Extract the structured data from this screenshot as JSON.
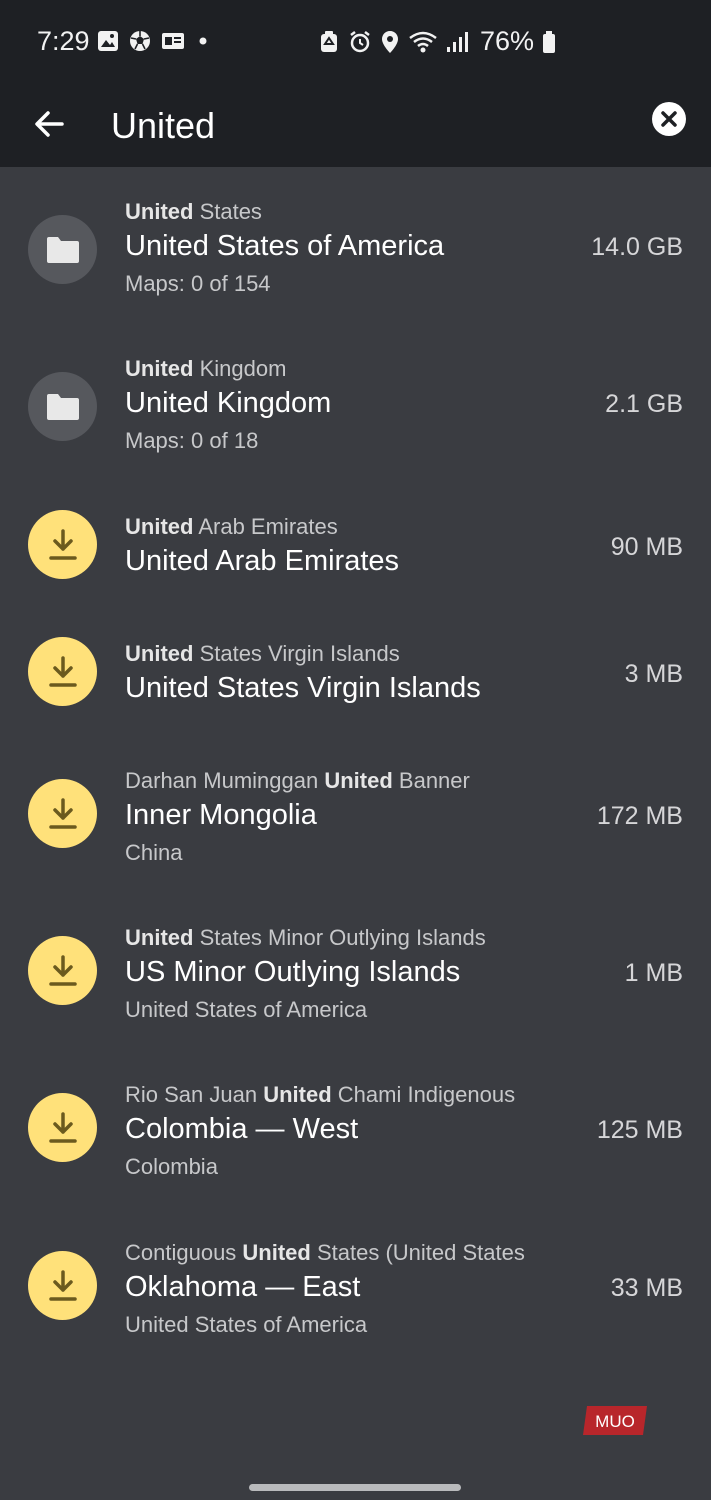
{
  "status_bar": {
    "time": "7:29",
    "battery_percent": "76%",
    "icons_left": [
      "gallery-icon",
      "soccer-ball-icon",
      "news-icon",
      "dot-icon"
    ],
    "icons_right": [
      "recycle-icon",
      "alarm-icon",
      "location-icon",
      "wifi-icon",
      "signal-icon",
      "battery-icon"
    ]
  },
  "app_bar": {
    "search_value": "United",
    "back_icon": "arrow-left-icon",
    "clear_icon": "close-circle-icon"
  },
  "results": [
    {
      "icon": "folder-icon",
      "kind": "folder",
      "sub_top_before": "",
      "sub_top_bold": "United",
      "sub_top_after": " States",
      "title": "United States of America",
      "sub_bottom": "Maps: 0 of 154",
      "size": "14.0 GB"
    },
    {
      "icon": "folder-icon",
      "kind": "folder",
      "sub_top_before": "",
      "sub_top_bold": "United",
      "sub_top_after": " Kingdom",
      "title": "United Kingdom",
      "sub_bottom": "Maps: 0 of 18",
      "size": "2.1 GB"
    },
    {
      "icon": "download-icon",
      "kind": "download",
      "sub_top_before": "",
      "sub_top_bold": "United",
      "sub_top_after": " Arab Emirates",
      "title": "United Arab Emirates",
      "sub_bottom": "",
      "size": "90 MB"
    },
    {
      "icon": "download-icon",
      "kind": "download",
      "sub_top_before": "",
      "sub_top_bold": "United",
      "sub_top_after": " States Virgin Islands",
      "title": "United States Virgin Islands",
      "sub_bottom": "",
      "size": "3 MB"
    },
    {
      "icon": "download-icon",
      "kind": "download",
      "sub_top_before": "Darhan Muminggan ",
      "sub_top_bold": "United",
      "sub_top_after": " Banner",
      "title": "Inner Mongolia",
      "sub_bottom": "China",
      "size": "172 MB"
    },
    {
      "icon": "download-icon",
      "kind": "download",
      "sub_top_before": "",
      "sub_top_bold": "United",
      "sub_top_after": " States Minor Outlying Islands",
      "title": "US Minor Outlying Islands",
      "sub_bottom": "United States of America",
      "size": "1 MB"
    },
    {
      "icon": "download-icon",
      "kind": "download",
      "sub_top_before": "Rio San Juan ",
      "sub_top_bold": "United",
      "sub_top_after": " Chami Indigenous",
      "title": "Colombia — West",
      "sub_bottom": "Colombia",
      "size": "125 MB"
    },
    {
      "icon": "download-icon",
      "kind": "download",
      "sub_top_before": "Contiguous ",
      "sub_top_bold": "United",
      "sub_top_after": " States (United States",
      "title": "Oklahoma — East",
      "sub_bottom": "United States of America",
      "size": "33 MB"
    }
  ],
  "watermark": {
    "text": "MUO"
  },
  "colors": {
    "background": "#3a3c41",
    "bar": "#1e2024",
    "folder_circle": "#56585d",
    "download_circle": "#ffe17a",
    "download_glyph": "#6b5a1e"
  }
}
